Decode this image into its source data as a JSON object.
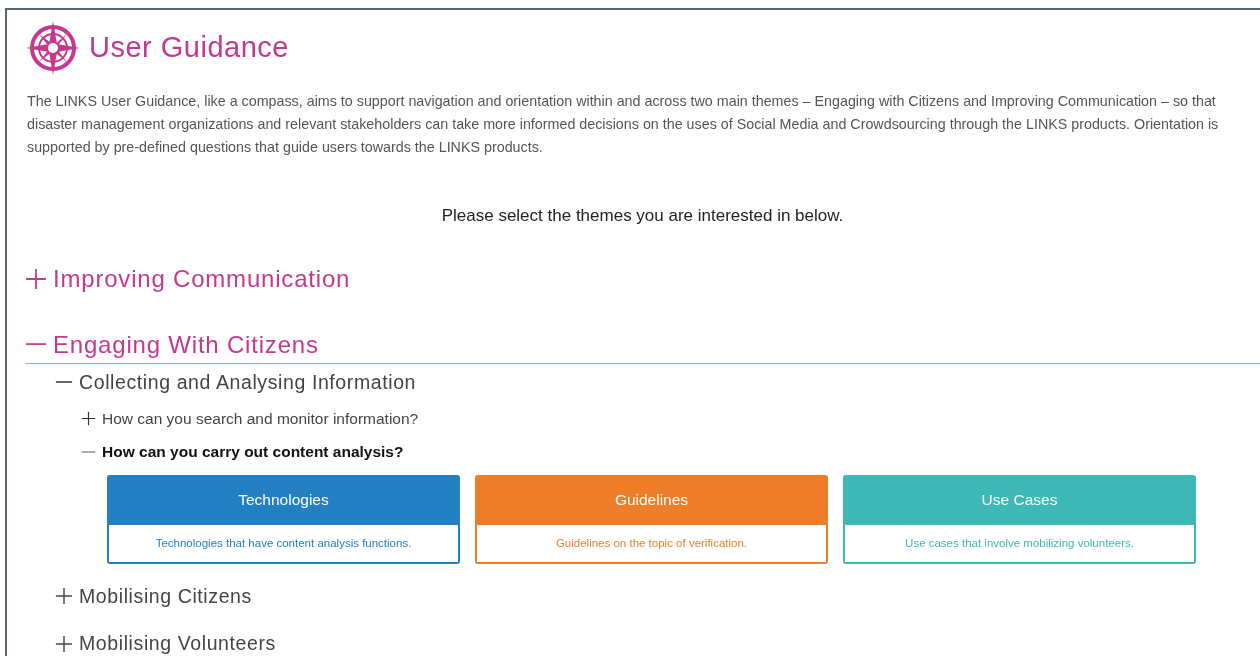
{
  "header": {
    "title": "User Guidance",
    "intro": "The LINKS User Guidance, like a compass, aims to support navigation and orientation within and across two main themes – Engaging with Citizens and Improving Communication – so that disaster management organizations and relevant stakeholders can take more informed decisions on the uses of Social Media and Crowdsourcing through the LINKS products. Orientation is supported by pre-defined questions that guide users towards the LINKS products."
  },
  "prompt": "Please select the themes you are interested in below.",
  "themes": [
    {
      "title": "Improving Communication",
      "expanded": false
    },
    {
      "title": "Engaging With Citizens",
      "expanded": true,
      "children": [
        {
          "title": "Collecting and Analysing Information",
          "expanded": true,
          "questions": [
            {
              "text": "How can you search and monitor information?",
              "expanded": false
            },
            {
              "text": "How can you carry out content analysis?",
              "expanded": true,
              "cards": [
                {
                  "title": "Technologies",
                  "description": "Technologies that have content analysis functions.",
                  "color": "#2280c3"
                },
                {
                  "title": "Guidelines",
                  "description": "Guidelines on the topic of verification.",
                  "color": "#ee7d2a"
                },
                {
                  "title": "Use Cases",
                  "description": "Use cases that involve mobilizing volunteers.",
                  "color": "#3db8b4"
                }
              ]
            }
          ]
        },
        {
          "title": "Mobilising Citizens",
          "expanded": false
        },
        {
          "title": "Mobilising Volunteers",
          "expanded": false
        }
      ]
    }
  ]
}
